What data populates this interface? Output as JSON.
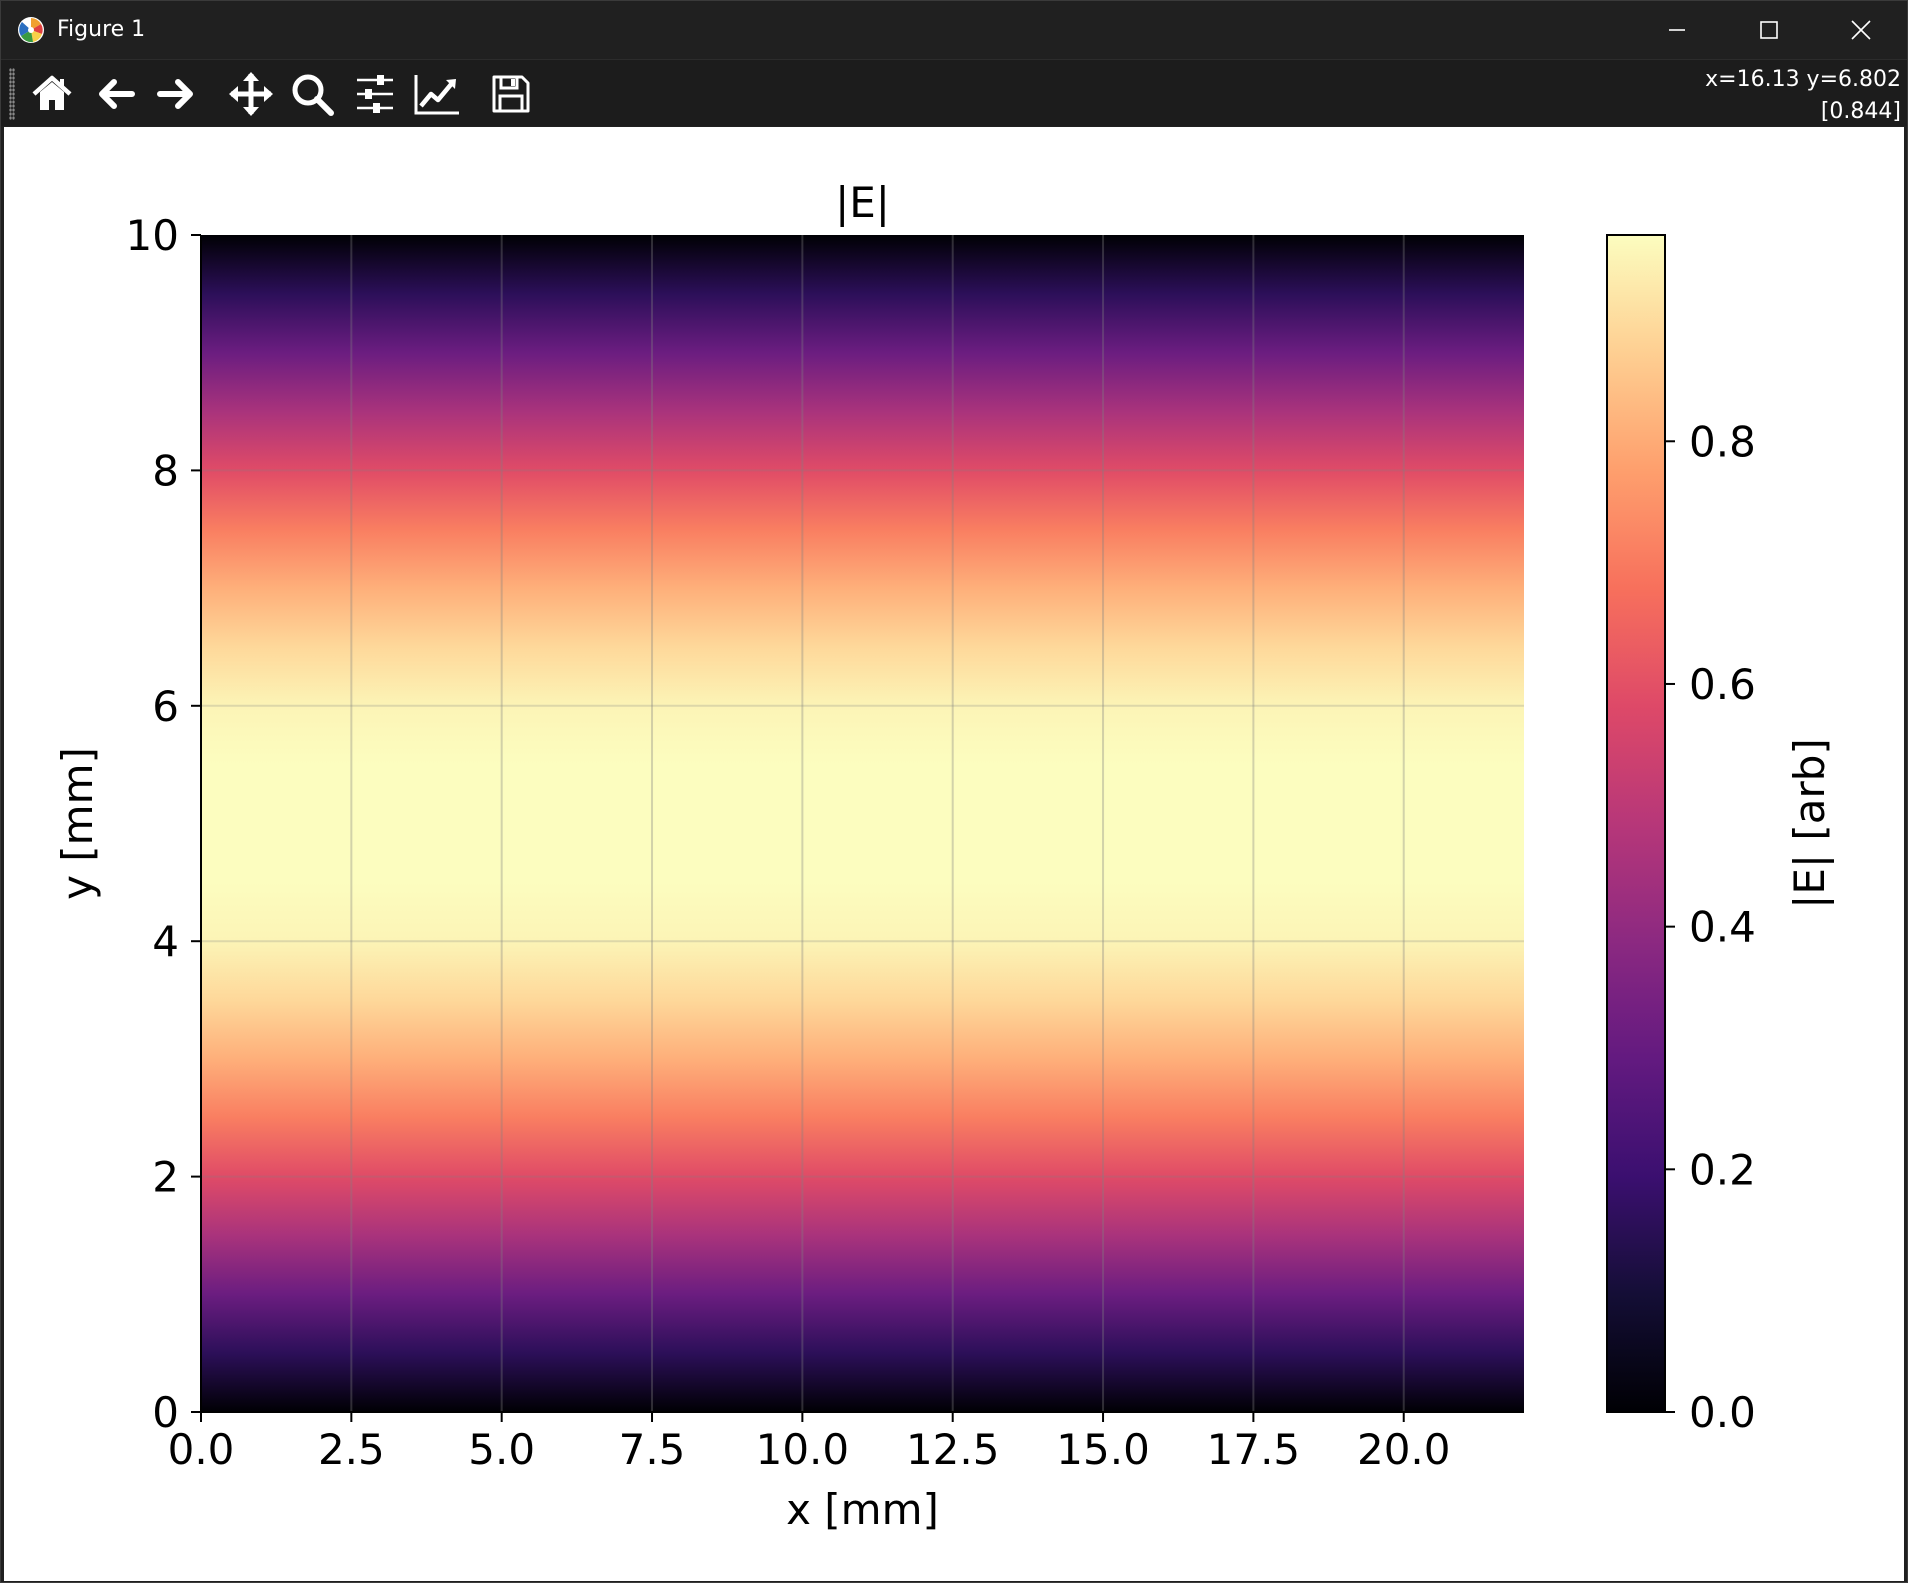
{
  "window": {
    "title": "Figure 1"
  },
  "toolbar": {
    "buttons": [
      {
        "name": "home",
        "icon": "home-icon"
      },
      {
        "name": "back",
        "icon": "arrow-left-icon"
      },
      {
        "name": "forward",
        "icon": "arrow-right-icon"
      },
      {
        "name": "pan",
        "icon": "move-icon"
      },
      {
        "name": "zoom",
        "icon": "magnifier-icon"
      },
      {
        "name": "subplots",
        "icon": "sliders-icon"
      },
      {
        "name": "customize",
        "icon": "line-chart-icon"
      },
      {
        "name": "save",
        "icon": "floppy-disk-icon"
      }
    ],
    "coords_line1": "x=16.13 y=6.802",
    "coords_line2": "[0.844]"
  },
  "colors": {
    "window_bg": "#202020",
    "toolbar_bg": "#1c1c1c",
    "figure_bg": "#ffffff"
  },
  "chart_data": {
    "type": "heatmap",
    "title": "|E|",
    "xlabel": "x [mm]",
    "ylabel": "y [mm]",
    "colorbar_label": "|E| [arb]",
    "colormap": "magma",
    "xlim": [
      0,
      22
    ],
    "ylim": [
      0,
      10
    ],
    "clim": [
      0,
      0.97
    ],
    "x_ticks": [
      "0.0",
      "2.5",
      "5.0",
      "7.5",
      "10.0",
      "12.5",
      "15.0",
      "17.5",
      "20.0"
    ],
    "x_tick_values": [
      0,
      2.5,
      5,
      7.5,
      10,
      12.5,
      15,
      17.5,
      20
    ],
    "y_ticks": [
      "0",
      "2",
      "4",
      "6",
      "8",
      "10"
    ],
    "y_tick_values": [
      0,
      2,
      4,
      6,
      8,
      10
    ],
    "colorbar_ticks": [
      "0.0",
      "0.2",
      "0.4",
      "0.6",
      "0.8"
    ],
    "colorbar_tick_values": [
      0,
      0.2,
      0.4,
      0.6,
      0.8
    ],
    "grid": true,
    "profile": {
      "description_of_field": "uniform in x, |sin(pi*y/10)|",
      "y": [
        0,
        0.5,
        1,
        1.5,
        2,
        2.5,
        3,
        3.5,
        4,
        4.5,
        5,
        5.5,
        6,
        6.5,
        7,
        7.5,
        8,
        8.5,
        9,
        9.5,
        10
      ],
      "values": [
        0.0,
        0.156,
        0.309,
        0.454,
        0.588,
        0.707,
        0.809,
        0.891,
        0.951,
        0.988,
        1.0,
        0.988,
        0.951,
        0.891,
        0.809,
        0.707,
        0.588,
        0.454,
        0.309,
        0.156,
        0.0
      ]
    }
  }
}
